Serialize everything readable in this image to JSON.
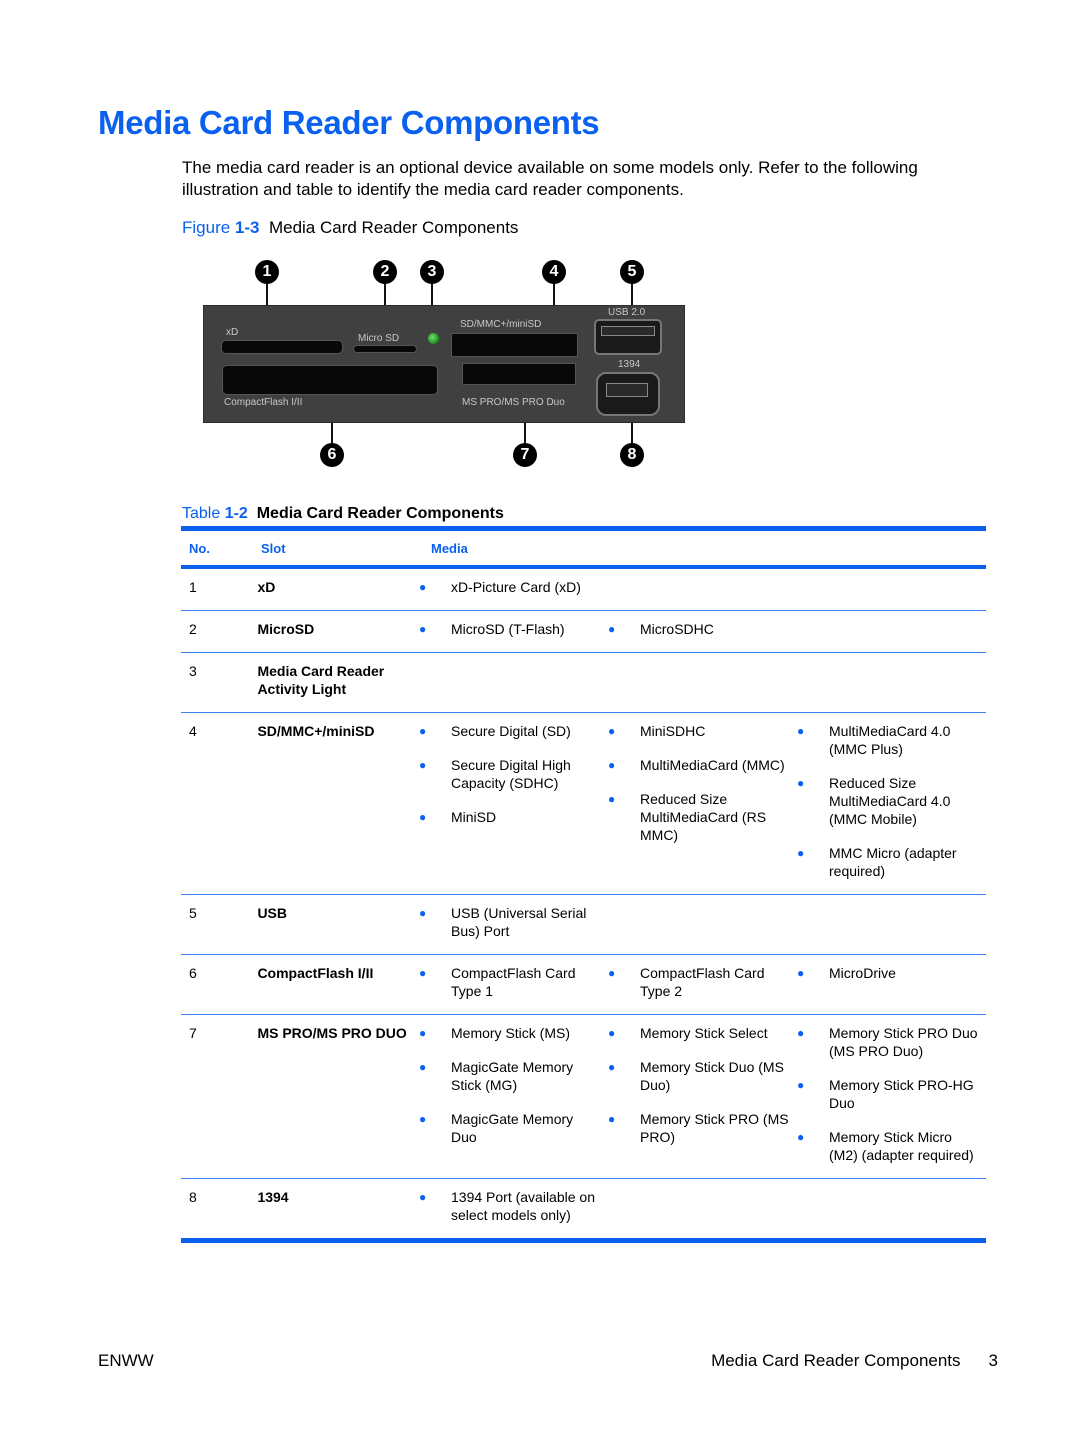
{
  "page": {
    "title": "Media Card Reader Components",
    "intro": "The media card reader is an optional device available on some models only. Refer to the following illustration and table to identify the media card reader components."
  },
  "figure": {
    "label_prefix": "Figure ",
    "label_num": "1-3",
    "caption": "Media Card Reader Components",
    "panel_labels": {
      "xd": "xD",
      "microsd": "Micro SD",
      "sd": "SD/MMC+/miniSD",
      "usb": "USB 2.0",
      "ieee1394": "1394",
      "cf": "CompactFlash I/II",
      "ms": "MS PRO/MS PRO Duo"
    },
    "callouts": [
      "1",
      "2",
      "3",
      "4",
      "5",
      "6",
      "7",
      "8"
    ],
    "led_color": "#2fae2f"
  },
  "table": {
    "label_prefix": "Table ",
    "label_num": "1-2",
    "caption": "Media Card Reader Components",
    "headers": {
      "no": "No.",
      "slot": "Slot",
      "media": "Media"
    },
    "accent_color": "#0a60ef",
    "bullet": "●",
    "rows": [
      {
        "no": "1",
        "slot": "xD",
        "media": [
          [
            "xD-Picture Card (xD)"
          ],
          [],
          []
        ]
      },
      {
        "no": "2",
        "slot": "MicroSD",
        "media": [
          [
            "MicroSD (T-Flash)"
          ],
          [
            "MicroSDHC"
          ],
          []
        ]
      },
      {
        "no": "3",
        "slot": "Media Card Reader Activity Light",
        "media": [
          [],
          [],
          []
        ]
      },
      {
        "no": "4",
        "slot": "SD/MMC+/miniSD",
        "media": [
          [
            "Secure Digital (SD)",
            "Secure Digital High Capacity (SDHC)",
            "MiniSD"
          ],
          [
            "MiniSDHC",
            "MultiMediaCard (MMC)",
            "Reduced Size MultiMediaCard (RS MMC)"
          ],
          [
            "MultiMediaCard 4.0 (MMC Plus)",
            "Reduced Size MultiMediaCard 4.0 (MMC Mobile)",
            "MMC Micro (adapter required)"
          ]
        ]
      },
      {
        "no": "5",
        "slot": "USB",
        "media": [
          [
            "USB (Universal Serial Bus) Port"
          ],
          [],
          []
        ]
      },
      {
        "no": "6",
        "slot": "CompactFlash I/II",
        "media": [
          [
            "CompactFlash Card Type 1"
          ],
          [
            "CompactFlash Card Type 2"
          ],
          [
            "MicroDrive"
          ]
        ]
      },
      {
        "no": "7",
        "slot": "MS PRO/MS PRO DUO",
        "media": [
          [
            "Memory Stick (MS)",
            "MagicGate Memory Stick (MG)",
            "MagicGate Memory Duo"
          ],
          [
            "Memory Stick Select",
            "Memory Stick Duo (MS Duo)",
            "Memory Stick PRO (MS PRO)"
          ],
          [
            "Memory Stick PRO Duo (MS PRO Duo)",
            "Memory Stick PRO-HG Duo",
            "Memory Stick Micro (M2) (adapter required)"
          ]
        ]
      },
      {
        "no": "8",
        "slot": "1394",
        "media": [
          [
            "1394 Port (available on select models only)"
          ],
          [],
          []
        ]
      }
    ]
  },
  "footer": {
    "left": "ENWW",
    "section": "Media Card Reader Components",
    "page_number": "3"
  }
}
